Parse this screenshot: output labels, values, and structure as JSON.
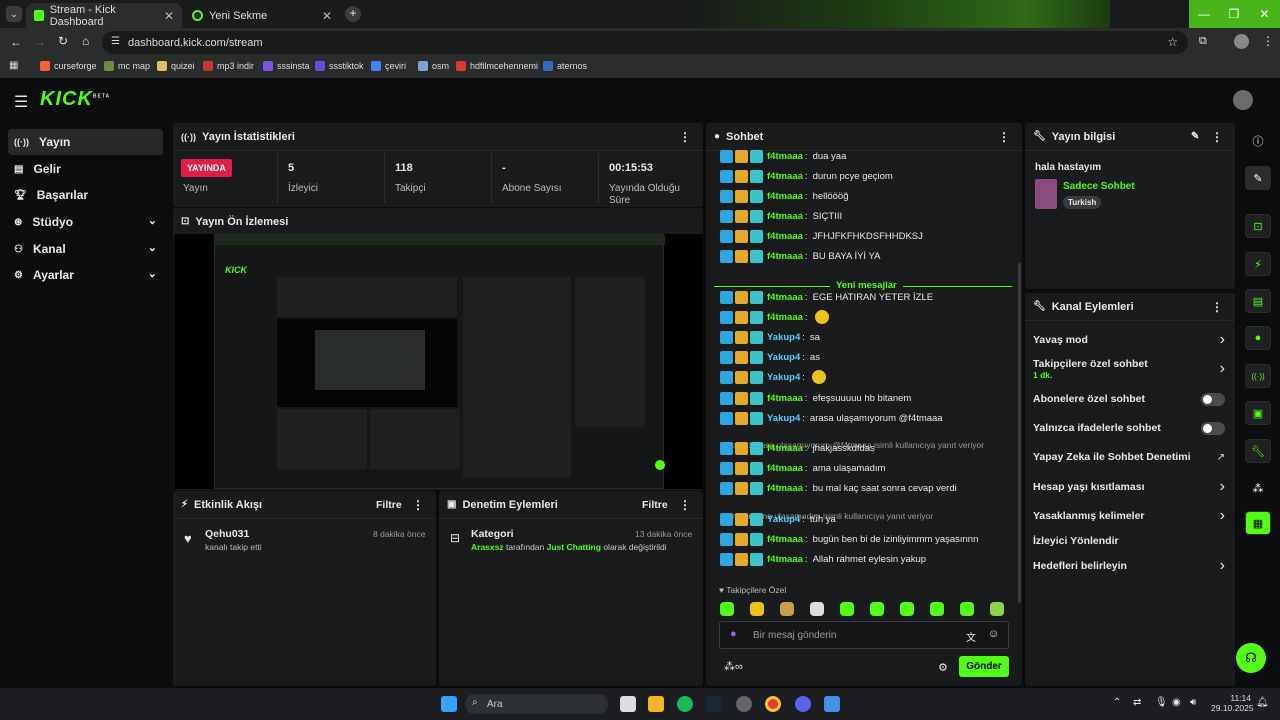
{
  "browser": {
    "tabs": [
      {
        "title": "Stream - Kick Dashboard"
      },
      {
        "title": "Yeni Sekme"
      }
    ],
    "url": "dashboard.kick.com/stream",
    "bookmarks": [
      "curseforge",
      "mc map",
      "quizei",
      "mp3 indir",
      "sssinsta",
      "ssstiktok",
      "çeviri",
      "osm",
      "hdfilmcehennemi",
      "aternos"
    ]
  },
  "brand": {
    "logo": "KICK",
    "badge": "BETA",
    "accent": "#53fc18"
  },
  "sidebar": {
    "items": [
      {
        "label": "Yayın",
        "icon": "broadcast-icon",
        "active": true
      },
      {
        "label": "Gelir",
        "icon": "revenue-icon"
      },
      {
        "label": "Başarılar",
        "icon": "trophy-icon"
      },
      {
        "label": "Stüdyo",
        "icon": "studio-icon",
        "expandable": true
      },
      {
        "label": "Kanal",
        "icon": "channel-icon",
        "expandable": true
      },
      {
        "label": "Ayarlar",
        "icon": "settings-icon",
        "expandable": true
      }
    ]
  },
  "stats": {
    "title": "Yayın İstatistikleri",
    "live_label": "YAYINDA",
    "items": [
      {
        "value": "",
        "label": "Yayın"
      },
      {
        "value": "5",
        "label": "İzleyici"
      },
      {
        "value": "118",
        "label": "Takipçi"
      },
      {
        "value": "-",
        "label": "Abone Sayısı"
      },
      {
        "value": "00:15:53",
        "label": "Yayında Olduğu Süre"
      }
    ]
  },
  "preview": {
    "title": "Yayın Ön İzlemesi"
  },
  "activity": {
    "title": "Etkinlik Akışı",
    "filter": "Filtre",
    "item": {
      "user": "Qehu031",
      "text": "kanalı takip etti",
      "time": "8 dakika önce"
    }
  },
  "moderation": {
    "title": "Denetim Eylemleri",
    "filter": "Filtre",
    "item": {
      "title": "Kategori",
      "time": "13 dakika önce",
      "actor": "Arasxsz",
      "mid": "tarafından",
      "category": "Just Chatting",
      "suffix": "olarak değiştirildi"
    }
  },
  "chat": {
    "title": "Sohbet",
    "new_messages": "Yeni mesajlar",
    "messages": [
      {
        "user": "f4tmaaa",
        "text": "dua yaa"
      },
      {
        "user": "f4tmaaa",
        "text": "durun pcye geçiom"
      },
      {
        "user": "f4tmaaa",
        "text": "hellöööğ"
      },
      {
        "user": "f4tmaaa",
        "text": "SIÇTIII"
      },
      {
        "user": "f4tmaaa",
        "text": "JFHJFKFHKDSFHHDKSJ"
      },
      {
        "user": "f4tmaaa",
        "text": "BU BAYA İYİ YA"
      },
      {
        "user": "f4tmaaa",
        "text": "EGE HATIRAN YETER İZLE"
      },
      {
        "user": "f4tmaaa",
        "text": ""
      },
      {
        "user": "Yakup4",
        "text": "sa"
      },
      {
        "user": "Yakup4",
        "text": "as"
      },
      {
        "user": "Yakup4",
        "text": ""
      },
      {
        "user": "f4tmaaa",
        "text": "efeşsuuuuu hb bitanem"
      },
      {
        "user": "Yakup4",
        "text": "arasa ulaşamıyorum @f4tmaaa"
      },
      {
        "user": "f4tmaaa",
        "text": "jhakjasskdfdas"
      },
      {
        "user": "f4tmaaa",
        "text": "ama ulaşamadım"
      },
      {
        "user": "f4tmaaa",
        "text": "bu mal kaç saat sonra cevap verdi"
      },
      {
        "user": "Yakup4",
        "text": "tüh ya"
      },
      {
        "user": "f4tmaaa",
        "text": "bugün ben bi de izinliyimmm yaşasınnn"
      },
      {
        "user": "f4tmaaa",
        "text": "Allah rahmet eylesin yakup"
      }
    ],
    "replies": [
      "Yakup4: arasa ulaşamıyorum @f4tmaaa isimli kullanıcıya yanıt veriyor",
      "f4tmaaa: ama ulaşamadım isimli kullanıcıya yanıt veriyor"
    ],
    "emote_label": "Takipçilere Özel",
    "input_placeholder": "Bir mesaj gönderin",
    "send": "Gönder"
  },
  "stream_info": {
    "title": "Yayın bilgisi",
    "stream_title": "hala hastayım",
    "category": "Sadece Sohbet",
    "tag": "Turkish"
  },
  "channel_actions": {
    "title": "Kanal Eylemleri",
    "items": [
      {
        "label": "Yavaş mod",
        "control": "arrow"
      },
      {
        "label": "Takipçilere özel sohbet",
        "sub": "1 dk.",
        "control": "arrow"
      },
      {
        "label": "Abonelere özel sohbet",
        "control": "toggle"
      },
      {
        "label": "Yalnızca ifadelerle sohbet",
        "control": "toggle"
      },
      {
        "label": "Yapay Zeka ile Sohbet Denetimi",
        "control": "external"
      },
      {
        "label": "Hesap yaşı kısıtlaması",
        "control": "arrow"
      },
      {
        "label": "Yasaklanmış kelimeler",
        "control": "arrow"
      },
      {
        "label": "İzleyici Yönlendir",
        "control": "none"
      },
      {
        "label": "Hedefleri belirleyin",
        "control": "arrow"
      }
    ]
  },
  "taskbar": {
    "search": "Ara",
    "time": "11:14",
    "date": "29.10.2025"
  }
}
